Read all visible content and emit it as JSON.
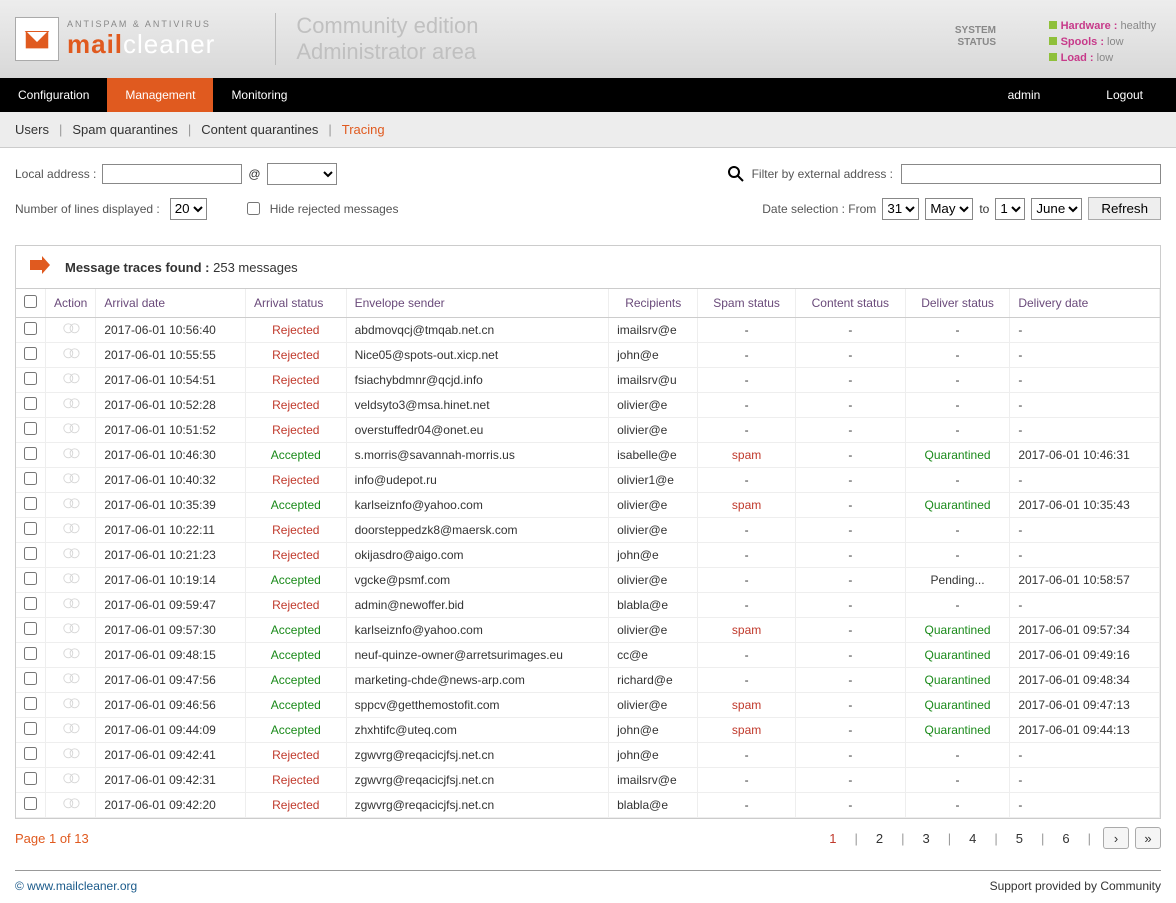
{
  "header": {
    "tagline": "ANTISPAM & ANTIVIRUS",
    "brand_prefix": "mail",
    "brand_suffix": "cleaner",
    "title1": "Community edition",
    "title2": "Administrator area",
    "system_label1": "SYSTEM",
    "system_label2": "STATUS",
    "status": [
      {
        "label": "Hardware :",
        "value": "healthy"
      },
      {
        "label": "Spools :",
        "value": "low"
      },
      {
        "label": "Load :",
        "value": "low"
      }
    ]
  },
  "nav": {
    "items": [
      "Configuration",
      "Management",
      "Monitoring"
    ],
    "active": 1,
    "user": "admin",
    "logout": "Logout"
  },
  "subnav": {
    "items": [
      "Users",
      "Spam quarantines",
      "Content quarantines",
      "Tracing"
    ],
    "active": 3
  },
  "filters": {
    "local_label": "Local address :",
    "at": "@",
    "lines_label": "Number of lines displayed :",
    "lines_value": "20",
    "hide_label": "Hide rejected messages",
    "ext_label": "Filter by external address :",
    "date_label": "Date selection : From",
    "from_day": "31",
    "from_month": "May",
    "to": "to",
    "to_day": "1",
    "to_month": "June",
    "refresh": "Refresh"
  },
  "found": {
    "label": "Message traces found :",
    "count": "253 messages"
  },
  "columns": [
    "Action",
    "Arrival date",
    "Arrival status",
    "Envelope sender",
    "Recipients",
    "Spam status",
    "Content status",
    "Deliver status",
    "Delivery date"
  ],
  "rows": [
    {
      "date": "2017-06-01 10:56:40",
      "status": "Rejected",
      "sender": "abdmovqcj@tmqab.net.cn",
      "recip": "imailsrv@e",
      "spam": "-",
      "content": "-",
      "deliver": "-",
      "ddate": "-"
    },
    {
      "date": "2017-06-01 10:55:55",
      "status": "Rejected",
      "sender": "Nice05@spots-out.xicp.net",
      "recip": "john@e",
      "spam": "-",
      "content": "-",
      "deliver": "-",
      "ddate": "-"
    },
    {
      "date": "2017-06-01 10:54:51",
      "status": "Rejected",
      "sender": "fsiachybdmnr@qcjd.info",
      "recip": "imailsrv@u",
      "spam": "-",
      "content": "-",
      "deliver": "-",
      "ddate": "-"
    },
    {
      "date": "2017-06-01 10:52:28",
      "status": "Rejected",
      "sender": "veldsyto3@msa.hinet.net",
      "recip": "olivier@e",
      "spam": "-",
      "content": "-",
      "deliver": "-",
      "ddate": "-"
    },
    {
      "date": "2017-06-01 10:51:52",
      "status": "Rejected",
      "sender": "overstuffedr04@onet.eu",
      "recip": "olivier@e",
      "spam": "-",
      "content": "-",
      "deliver": "-",
      "ddate": "-"
    },
    {
      "date": "2017-06-01 10:46:30",
      "status": "Accepted",
      "sender": "s.morris@savannah-morris.us",
      "recip": "isabelle@e",
      "spam": "spam",
      "content": "-",
      "deliver": "Quarantined",
      "ddate": "2017-06-01 10:46:31"
    },
    {
      "date": "2017-06-01 10:40:32",
      "status": "Rejected",
      "sender": "info@udepot.ru",
      "recip": "olivier1@e",
      "spam": "-",
      "content": "-",
      "deliver": "-",
      "ddate": "-"
    },
    {
      "date": "2017-06-01 10:35:39",
      "status": "Accepted",
      "sender": "karlseiznfo@yahoo.com",
      "recip": "olivier@e",
      "spam": "spam",
      "content": "-",
      "deliver": "Quarantined",
      "ddate": "2017-06-01 10:35:43"
    },
    {
      "date": "2017-06-01 10:22:11",
      "status": "Rejected",
      "sender": "doorsteppedzk8@maersk.com",
      "recip": "olivier@e",
      "spam": "-",
      "content": "-",
      "deliver": "-",
      "ddate": "-"
    },
    {
      "date": "2017-06-01 10:21:23",
      "status": "Rejected",
      "sender": "okijasdro@aigo.com",
      "recip": "john@e",
      "spam": "-",
      "content": "-",
      "deliver": "-",
      "ddate": "-"
    },
    {
      "date": "2017-06-01 10:19:14",
      "status": "Accepted",
      "sender": "vgcke@psmf.com",
      "recip": "olivier@e",
      "spam": "-",
      "content": "-",
      "deliver": "Pending...",
      "ddate": "2017-06-01 10:58:57"
    },
    {
      "date": "2017-06-01 09:59:47",
      "status": "Rejected",
      "sender": "admin@newoffer.bid",
      "recip": "blabla@e",
      "spam": "-",
      "content": "-",
      "deliver": "-",
      "ddate": "-"
    },
    {
      "date": "2017-06-01 09:57:30",
      "status": "Accepted",
      "sender": "karlseiznfo@yahoo.com",
      "recip": "olivier@e",
      "spam": "spam",
      "content": "-",
      "deliver": "Quarantined",
      "ddate": "2017-06-01 09:57:34"
    },
    {
      "date": "2017-06-01 09:48:15",
      "status": "Accepted",
      "sender": "neuf-quinze-owner@arretsurimages.eu",
      "recip": "cc@e",
      "spam": "-",
      "content": "-",
      "deliver": "Quarantined",
      "ddate": "2017-06-01 09:49:16"
    },
    {
      "date": "2017-06-01 09:47:56",
      "status": "Accepted",
      "sender": "marketing-chde@news-arp.com",
      "recip": "richard@e",
      "spam": "-",
      "content": "-",
      "deliver": "Quarantined",
      "ddate": "2017-06-01 09:48:34"
    },
    {
      "date": "2017-06-01 09:46:56",
      "status": "Accepted",
      "sender": "sppcv@getthemostofit.com",
      "recip": "olivier@e",
      "spam": "spam",
      "content": "-",
      "deliver": "Quarantined",
      "ddate": "2017-06-01 09:47:13"
    },
    {
      "date": "2017-06-01 09:44:09",
      "status": "Accepted",
      "sender": "zhxhtifc@uteq.com",
      "recip": "john@e",
      "spam": "spam",
      "content": "-",
      "deliver": "Quarantined",
      "ddate": "2017-06-01 09:44:13"
    },
    {
      "date": "2017-06-01 09:42:41",
      "status": "Rejected",
      "sender": "zgwvrg@reqacicjfsj.net.cn",
      "recip": "john@e",
      "spam": "-",
      "content": "-",
      "deliver": "-",
      "ddate": "-"
    },
    {
      "date": "2017-06-01 09:42:31",
      "status": "Rejected",
      "sender": "zgwvrg@reqacicjfsj.net.cn",
      "recip": "imailsrv@e",
      "spam": "-",
      "content": "-",
      "deliver": "-",
      "ddate": "-"
    },
    {
      "date": "2017-06-01 09:42:20",
      "status": "Rejected",
      "sender": "zgwvrg@reqacicjfsj.net.cn",
      "recip": "blabla@e",
      "spam": "-",
      "content": "-",
      "deliver": "-",
      "ddate": "-"
    }
  ],
  "pager": {
    "info": "Page 1 of 13",
    "pages": [
      "1",
      "2",
      "3",
      "4",
      "5",
      "6"
    ],
    "active": 0
  },
  "footer": {
    "link": "© www.mailcleaner.org",
    "right": "Support provided by Community"
  }
}
